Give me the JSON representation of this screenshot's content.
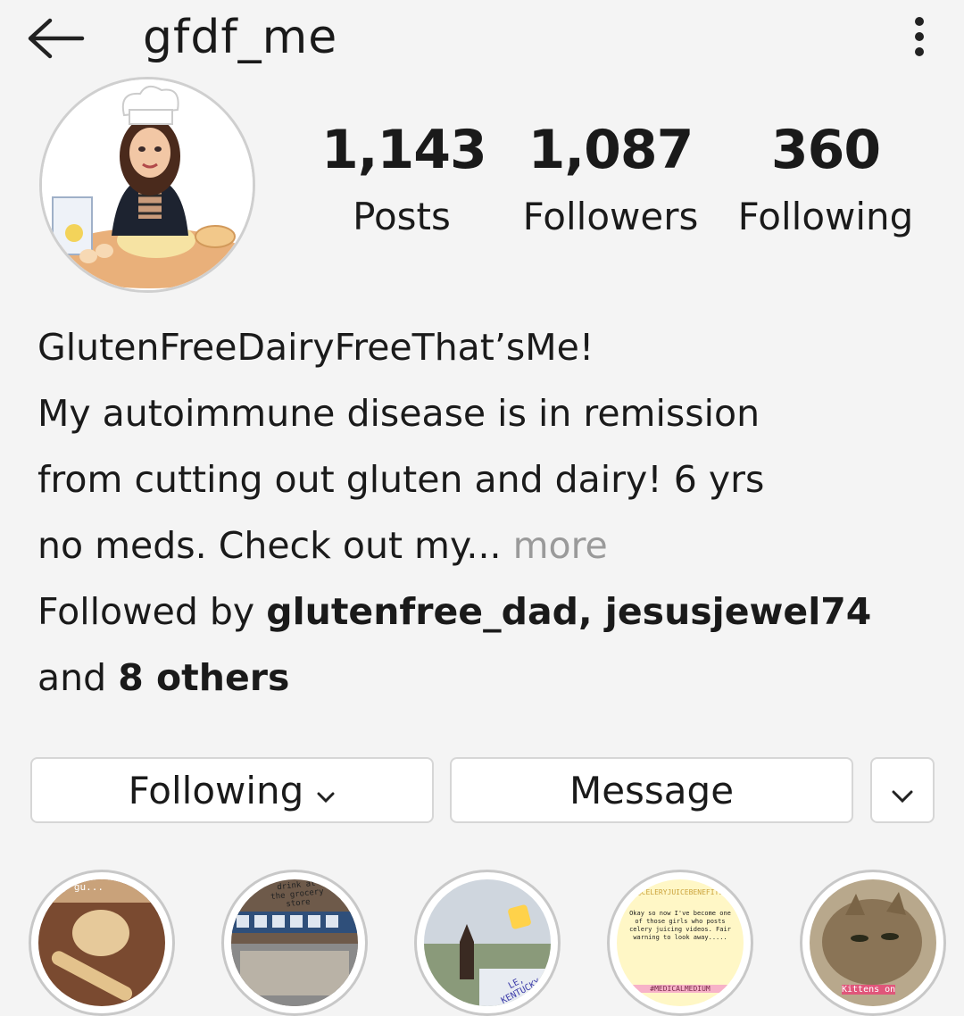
{
  "header": {
    "username": "gfdf_me"
  },
  "stats": [
    {
      "value": "1,143",
      "label": "Posts"
    },
    {
      "value": "1,087",
      "label": "Followers"
    },
    {
      "value": "360",
      "label": "Following"
    }
  ],
  "bio": {
    "name": "GlutenFreeDairyFreeThat’sMe!",
    "line1": "My autoimmune disease is in remission",
    "line2": "from cutting out gluten and dairy!  6 yrs",
    "line3": "no meds. Check out my...",
    "more": "more",
    "followed_prefix": "Followed by",
    "followed_names": "glutenfree_dad, jesusjewel74",
    "and_word": "and",
    "others": "8 others"
  },
  "buttons": {
    "following_label": "Following",
    "message_label": "Message"
  },
  "highlights": [
    {
      "icon": "dough-photo",
      "caption": "my gu..."
    },
    {
      "icon": "grocery-store-photo",
      "caption": "drink at the grocery store"
    },
    {
      "icon": "horse-photo",
      "caption": "LE, KENTUCKY"
    },
    {
      "icon": "text-note",
      "top": "@CELERYJUICEBENEFITS",
      "body": "Okay so now I've become one of those girls who posts celery juicing videos. Fair warning to look away.....",
      "tag": "#MEDICALMEDIUM"
    },
    {
      "icon": "cat-photo",
      "caption": "Kittens on"
    }
  ],
  "colors": {
    "bg": "#f4f4f4",
    "muted": "#9a9a9a",
    "border": "#d6d6d6"
  }
}
